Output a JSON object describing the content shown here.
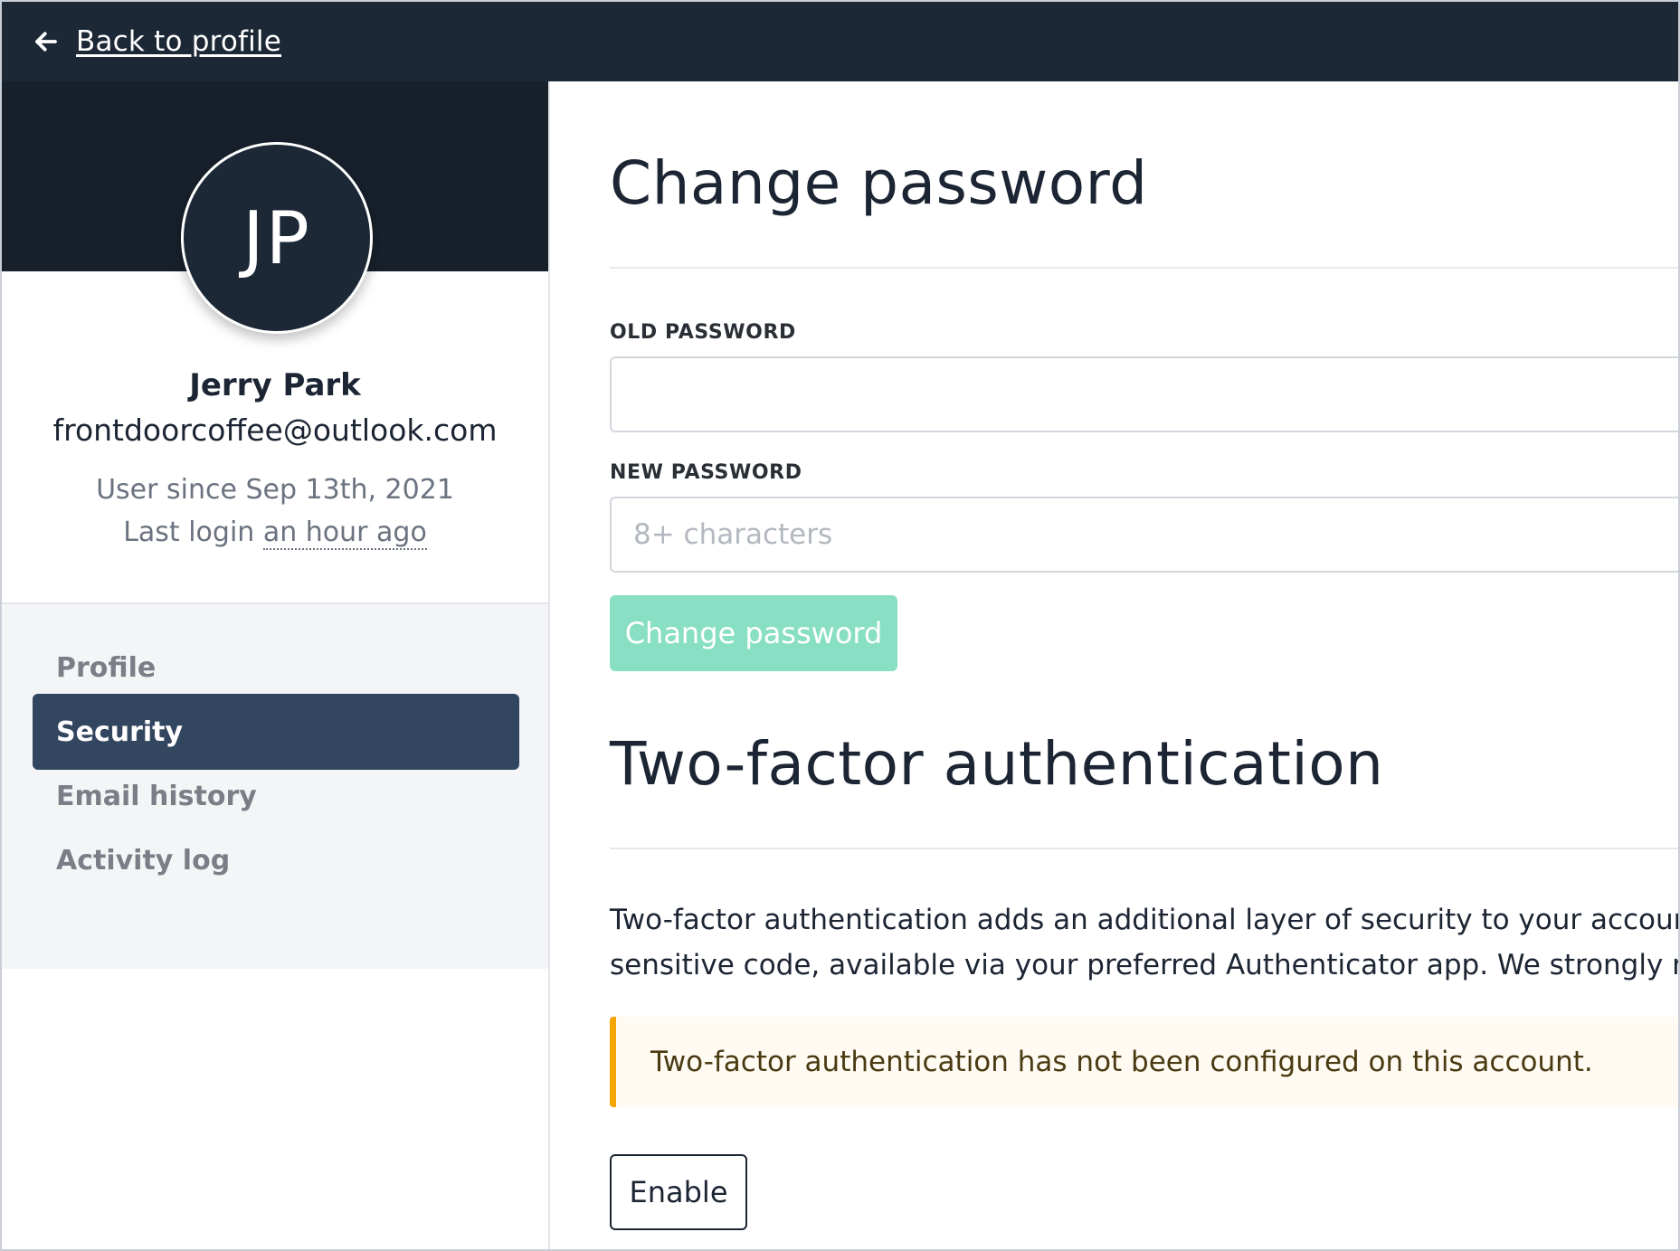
{
  "topbar": {
    "back_label": "Back to profile",
    "back_icon": "arrow-left-icon"
  },
  "profile": {
    "initials": "JP",
    "name": "Jerry Park",
    "email": "frontdoorcoffee@outlook.com",
    "user_since": "User since Sep 13th, 2021",
    "last_login_prefix": "Last login",
    "last_login_relative": "an hour ago"
  },
  "nav": {
    "items": [
      {
        "label": "Profile",
        "active": false
      },
      {
        "label": "Security",
        "active": true
      },
      {
        "label": "Email history",
        "active": false
      },
      {
        "label": "Activity log",
        "active": false
      }
    ]
  },
  "change_password": {
    "title": "Change password",
    "old_label": "OLD PASSWORD",
    "old_value": "",
    "new_label": "NEW PASSWORD",
    "new_placeholder": "8+ characters",
    "submit_label": "Change password"
  },
  "two_factor": {
    "title": "Two-factor authentication",
    "description_line1": "Two-factor authentication adds an additional layer of security to your account; o",
    "description_line2": "sensitive code, available via your preferred Authenticator app. We strongly recon",
    "alert": "Two-factor authentication has not been configured on this account.",
    "enable_label": "Enable"
  },
  "colors": {
    "topbar": "#1c2836",
    "nav_active": "#334660",
    "primary_button": "#89dfc3",
    "alert_border": "#f5a400"
  }
}
